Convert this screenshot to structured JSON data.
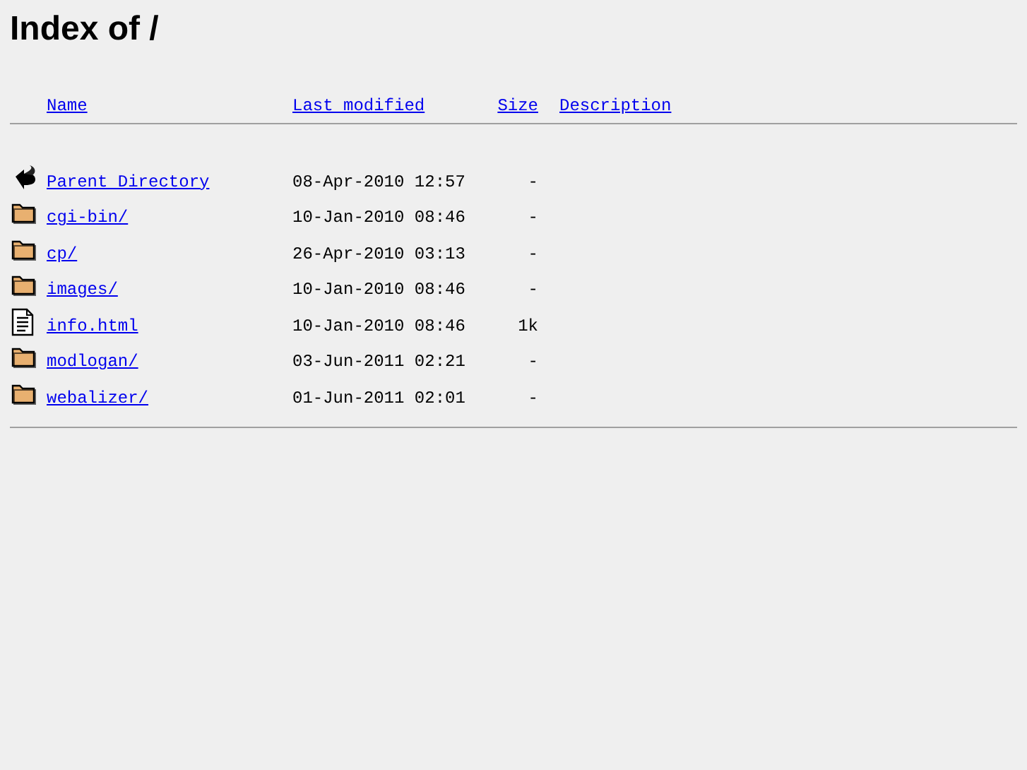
{
  "title": "Index of /",
  "columns": [
    "Name",
    "Last modified",
    "Size",
    "Description"
  ],
  "rows": [
    {
      "kind": "back",
      "name": "Parent Directory",
      "modified": "08-Apr-2010 12:57",
      "size": "-"
    },
    {
      "kind": "folder",
      "name": "cgi-bin/",
      "modified": "10-Jan-2010 08:46",
      "size": "-"
    },
    {
      "kind": "folder",
      "name": "cp/",
      "modified": "26-Apr-2010 03:13",
      "size": "-"
    },
    {
      "kind": "folder",
      "name": "images/",
      "modified": "10-Jan-2010 08:46",
      "size": "-"
    },
    {
      "kind": "text",
      "name": "info.html",
      "modified": "10-Jan-2010 08:46",
      "size": "1k"
    },
    {
      "kind": "folder",
      "name": "modlogan/",
      "modified": "03-Jun-2011 02:21",
      "size": "-"
    },
    {
      "kind": "folder",
      "name": "webalizer/",
      "modified": "01-Jun-2011 02:01",
      "size": "-"
    }
  ]
}
